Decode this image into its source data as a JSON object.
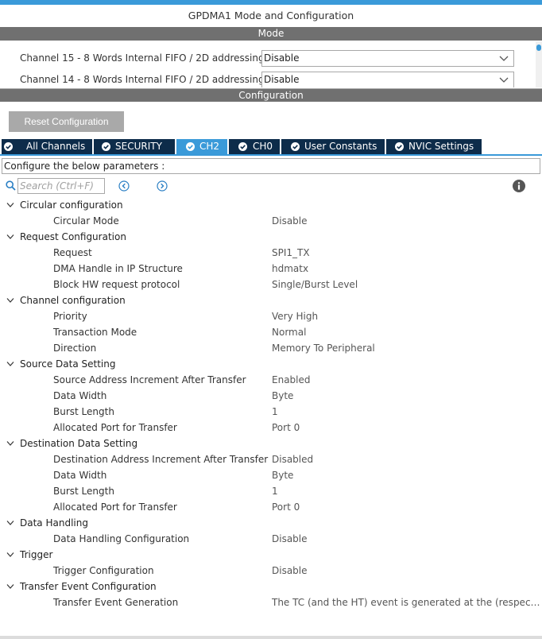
{
  "window": {
    "title": "GPDMA1 Mode and Configuration"
  },
  "mode": {
    "section_label": "Mode",
    "rows": [
      {
        "label": "Channel 15 - 8 Words Internal FIFO / 2D addressing",
        "value": "Disable"
      },
      {
        "label": "Channel 14 - 8 Words Internal FIFO / 2D addressing",
        "value": "Disable"
      }
    ]
  },
  "configuration": {
    "section_label": "Configuration",
    "reset_label": "Reset Configuration",
    "tabs": [
      {
        "label": "All Channels"
      },
      {
        "label": "SECURITY"
      },
      {
        "label": "CH2"
      },
      {
        "label": "CH0"
      },
      {
        "label": "User Constants"
      },
      {
        "label": "NVIC Settings"
      }
    ],
    "params_label": "Configure the below parameters :",
    "search_placeholder": "Search (Ctrl+F)"
  },
  "tree": [
    {
      "label": "Circular configuration",
      "params": [
        {
          "label": "Circular Mode",
          "value": "Disable"
        }
      ]
    },
    {
      "label": "Request Configuration",
      "params": [
        {
          "label": "Request",
          "value": "SPI1_TX"
        },
        {
          "label": "DMA Handle in IP Structure",
          "value": "hdmatx"
        },
        {
          "label": "Block HW request protocol",
          "value": "Single/Burst Level"
        }
      ]
    },
    {
      "label": "Channel configuration",
      "params": [
        {
          "label": "Priority",
          "value": "Very High"
        },
        {
          "label": "Transaction Mode",
          "value": "Normal"
        },
        {
          "label": "Direction",
          "value": "Memory To Peripheral"
        }
      ]
    },
    {
      "label": "Source Data Setting",
      "params": [
        {
          "label": "Source Address Increment After Transfer",
          "value": "Enabled"
        },
        {
          "label": "Data Width",
          "value": "Byte"
        },
        {
          "label": "Burst Length",
          "value": "1"
        },
        {
          "label": "Allocated Port for Transfer",
          "value": "Port 0"
        }
      ]
    },
    {
      "label": "Destination Data Setting",
      "params": [
        {
          "label": "Destination Address Increment After Transfer",
          "value": "Disabled"
        },
        {
          "label": "Data Width",
          "value": "Byte"
        },
        {
          "label": "Burst Length",
          "value": "1"
        },
        {
          "label": "Allocated Port for Transfer",
          "value": "Port 0"
        }
      ]
    },
    {
      "label": "Data Handling",
      "params": [
        {
          "label": "Data Handling Configuration",
          "value": "Disable"
        }
      ]
    },
    {
      "label": "Trigger",
      "params": [
        {
          "label": "Trigger Configuration",
          "value": "Disable"
        }
      ]
    },
    {
      "label": "Transfer Event Configuration",
      "params": [
        {
          "label": "Transfer Event Generation",
          "value": "The TC (and the HT) event is generated at the (respectiv..."
        }
      ]
    }
  ],
  "colors": {
    "accent": "#3a9ad9",
    "tab_dark": "#0d2c4a",
    "section_bar": "#707070"
  },
  "icons": {
    "search": "search-icon",
    "prev": "arrow-left-circle-icon",
    "next": "arrow-right-circle-icon",
    "info": "info-icon",
    "tab_check": "check-circle-icon",
    "expand": "chevron-down-icon"
  }
}
